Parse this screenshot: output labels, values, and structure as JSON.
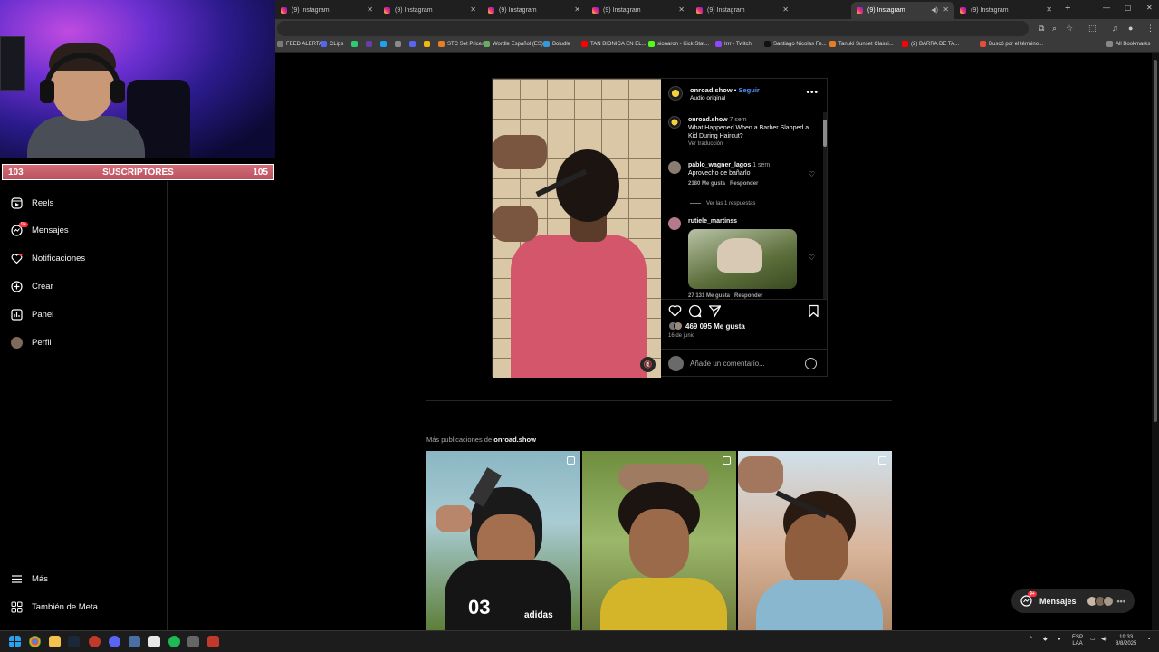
{
  "browser": {
    "tabs": [
      {
        "label": "(9) Instagram",
        "active": false
      },
      {
        "label": "(9) Instagram",
        "active": false
      },
      {
        "label": "(9) Instagram",
        "active": false
      },
      {
        "label": "(9) Instagram",
        "active": false
      },
      {
        "label": "(9) Instagram",
        "active": false
      },
      {
        "label": "(9) Instagram",
        "active": true
      },
      {
        "label": "(9) Instagram",
        "active": false
      }
    ],
    "bookmarks": [
      {
        "label": "FEED ALERTAS",
        "color": "#7a7a7a"
      },
      {
        "label": "CLips",
        "color": "#5865f2"
      },
      {
        "label": "",
        "color": "#2ecc71"
      },
      {
        "label": "",
        "color": "#6441a5"
      },
      {
        "label": "",
        "color": "#1da1f2"
      },
      {
        "label": "",
        "color": "#8a8a8a"
      },
      {
        "label": "",
        "color": "#5865f2"
      },
      {
        "label": "",
        "color": "#f0b90b"
      },
      {
        "label": "STC Set Prices",
        "color": "#e67e22"
      },
      {
        "label": "Wordle Español (ES)",
        "color": "#6aaa64"
      },
      {
        "label": "Boludle",
        "color": "#3498db"
      },
      {
        "label": "TAN BIONICA EN EL...",
        "color": "#ff0000"
      },
      {
        "label": "sionaron - Kick Stat...",
        "color": "#53fc18"
      },
      {
        "label": "Irrr - Twitch",
        "color": "#9146ff"
      },
      {
        "label": "Santiago Nicolas Fe...",
        "color": "#111111"
      },
      {
        "label": "Tanuki Sunset Classi...",
        "color": "#e67e22"
      },
      {
        "label": "(2) BARRA DE TA...",
        "color": "#ff0000"
      },
      {
        "label": "Buscó por el término...",
        "color": "#e74c3c"
      },
      {
        "label": "All Bookmarks",
        "color": "#888888"
      }
    ]
  },
  "stream_overlay": {
    "subs_current": "103",
    "subs_label": "SUSCRIPTORES",
    "subs_goal": "105"
  },
  "sidebar": {
    "items": [
      {
        "label": "Reels",
        "icon": "reels-icon"
      },
      {
        "label": "Mensajes",
        "icon": "messenger-icon",
        "badge": "9+"
      },
      {
        "label": "Notificaciones",
        "icon": "heart-icon"
      },
      {
        "label": "Crear",
        "icon": "plus-square-icon"
      },
      {
        "label": "Panel",
        "icon": "chart-icon"
      },
      {
        "label": "Perfil",
        "icon": "avatar-icon"
      }
    ],
    "more": "Más",
    "meta": "También de Meta"
  },
  "post": {
    "username": "onroad.show",
    "separator": "•",
    "follow": "Seguir",
    "audio": "Audio original",
    "caption": {
      "username": "onroad.show",
      "time": "7 sem",
      "text": "What Happened When a Barber Slapped a Kid During Haircut?",
      "translate": "Ver traducción"
    },
    "comments": [
      {
        "username": "pablo_wagner_lagos",
        "time": "1 sem",
        "text": "Aprovecho de bañarlo",
        "likes": "2180 Me gusta",
        "reply": "Responder",
        "view_replies": "Ver las 1 respuestas"
      },
      {
        "username": "rutiele_martinss",
        "likes": "27 131 Me gusta",
        "reply": "Responder"
      }
    ],
    "likes": "469 095 Me gusta",
    "date": "16 de junio",
    "add_comment_placeholder": "Añade un comentario..."
  },
  "more_posts": {
    "prefix": "Más publicaciones de",
    "username": "onroad.show",
    "thumbs": [
      {
        "shirt_text": "03",
        "brand_text": "adidas"
      },
      {},
      {}
    ]
  },
  "messages_pill": {
    "label": "Mensajes",
    "badge": "9+"
  },
  "taskbar": {
    "lang_top": "ESP",
    "lang_bottom": "LAA",
    "time": "19:33",
    "date": "8/8/2025"
  }
}
